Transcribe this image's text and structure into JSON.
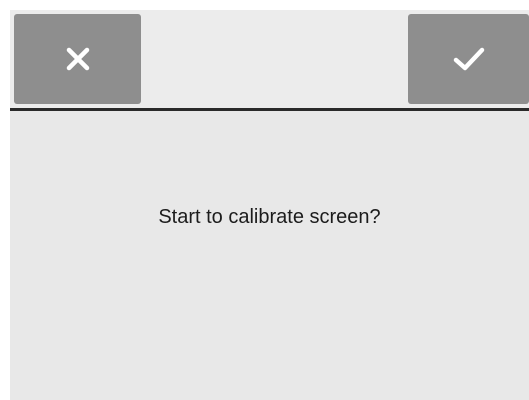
{
  "dialog": {
    "message": "Start to calibrate screen?",
    "cancel_icon": "close-icon",
    "confirm_icon": "checkmark-icon"
  },
  "colors": {
    "background": "#e8e8e8",
    "button": "#8e8e8e",
    "icon": "#ffffff",
    "divider": "#2a2a2a"
  }
}
